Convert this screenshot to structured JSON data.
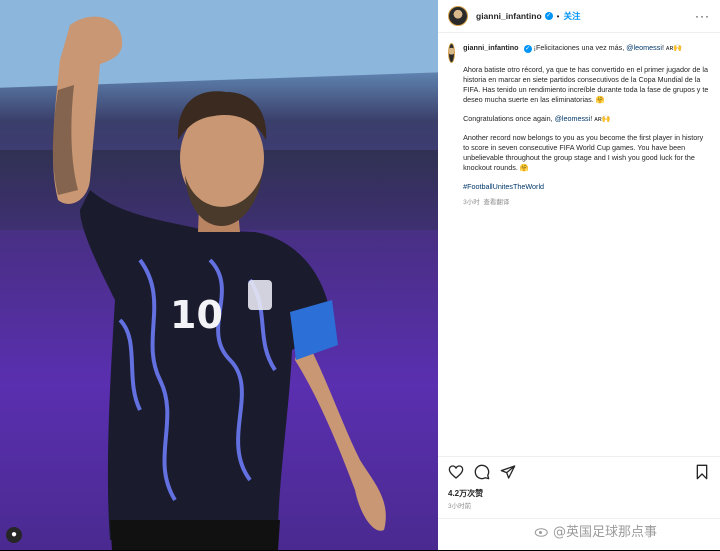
{
  "post": {
    "username": "gianni_infantino",
    "follow_label": "关注",
    "comment_username": "gianni_infantino",
    "intro": "¡Felicitaciones una vez más,",
    "mention": "@leomessi",
    "intro_suffix": "! ᴀʀ🙌",
    "spanish": "Ahora batiste otro récord, ya que te has convertido en el primer jugador de la historia en marcar en siete partidos consecutivos de la Copa Mundial de la FIFA. Has tenido un rendimiento increíble durante toda la fase de grupos y te deseo mucha suerte en las eliminatorias. 🤗",
    "congrats": "Congratulations once again,",
    "congrats_mention": "@leomessi",
    "congrats_suffix": "! ᴀʀ🙌",
    "english": "Another record now belongs to you as you become the first player in history to score in seven consecutive FIFA World Cup games. You have been unbelievable throughout the group stage and I wish you good luck for the knockout rounds. 🤗",
    "hashtag": "#FootballUnitesTheWorld",
    "comment_time": "3小时",
    "see_translation": "查看翻译",
    "likes": "4.2万次赞",
    "posted_ago": "3小时前"
  },
  "jersey_number": "10",
  "watermark": "@英国足球那点事",
  "colors": {
    "accent": "#0095f6",
    "link": "#00376b",
    "muted": "#8e8e8e"
  },
  "icons": [
    "heart-icon",
    "comment-icon",
    "share-icon",
    "bookmark-icon",
    "more-icon",
    "verified-icon"
  ]
}
